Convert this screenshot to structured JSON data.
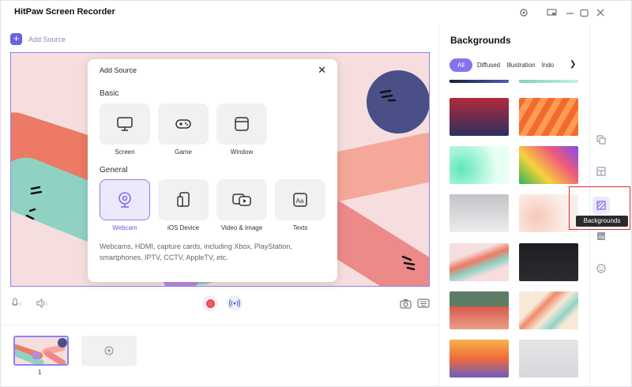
{
  "app": {
    "title": "HitPaw Screen Recorder"
  },
  "toolbar": {
    "add_source_label": "Add Source"
  },
  "modal": {
    "title": "Add Source",
    "sections": {
      "basic": "Basic",
      "general": "General"
    },
    "basic_items": [
      {
        "label": "Screen",
        "icon": "monitor-icon"
      },
      {
        "label": "Game",
        "icon": "gamepad-icon"
      },
      {
        "label": "Window",
        "icon": "window-icon"
      }
    ],
    "general_items": [
      {
        "label": "Webcam",
        "icon": "webcam-icon",
        "selected": true
      },
      {
        "label": "iOS Device",
        "icon": "ios-device-icon",
        "selected": false
      },
      {
        "label": "Video & Image",
        "icon": "video-image-icon",
        "selected": false
      },
      {
        "label": "Texts",
        "icon": "texts-icon",
        "selected": false
      }
    ],
    "description": "Webcams, HDMI, capture cards, including Xbox, PlayStation, smartphones, IPTV, CCTV, AppleTV, etc."
  },
  "scenes": {
    "items": [
      {
        "number": "1"
      }
    ]
  },
  "backgrounds": {
    "title": "Backgrounds",
    "filters": [
      "All",
      "Diffused",
      "Illustration",
      "Indo"
    ],
    "active_filter": "All",
    "tooltip": "Backgrounds"
  },
  "colors": {
    "accent": "#6b5ee8",
    "accent_light": "#ece9fc",
    "record_red": "#f35d5d",
    "highlight_red": "#e02b2b"
  }
}
